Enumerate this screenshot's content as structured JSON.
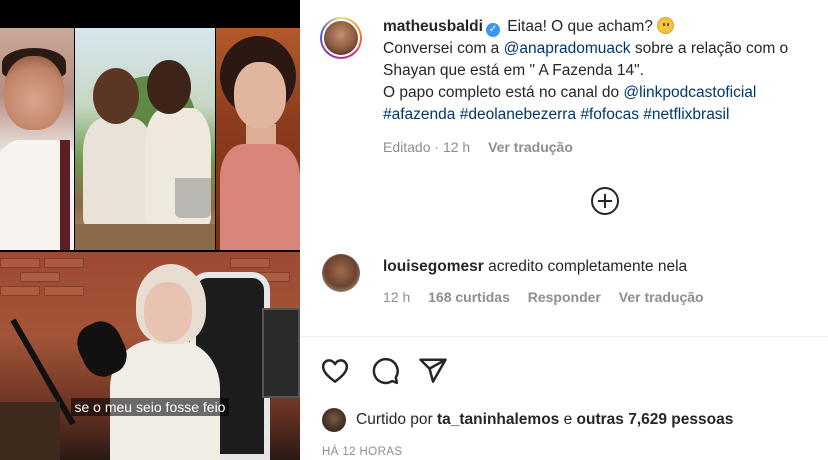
{
  "media": {
    "caption": "se o meu seio fosse feio"
  },
  "post": {
    "username": "matheusbaldi",
    "caption_intro": "Eitaa! O que acham?",
    "line2_prefix": "Conversei com a ",
    "mention_1": "@anapradomuack",
    "line2_suffix": " sobre a relação com o Shayan que está em \" A Fazenda 14\".",
    "line3_prefix": "O papo completo está no canal do ",
    "mention_2": "@linkpodcastoficial",
    "hashtags": [
      "#afazenda",
      "#deolanebezerra",
      "#fofocas",
      "#netflixbrasil"
    ],
    "edited_label": "Editado",
    "edited_time": "12 h",
    "see_translation": "Ver tradução"
  },
  "comment": {
    "username": "louisegomesr",
    "text": "acredito completamente nela",
    "time": "12 h",
    "likes": "168 curtidas",
    "reply": "Responder",
    "see_translation": "Ver tradução"
  },
  "likes": {
    "prefix": "Curtido por ",
    "user": "ta_taninhalemos",
    "middle": " e ",
    "others": "outras 7,629 pessoas"
  },
  "timestamp": "HÁ 12 HORAS",
  "colors": {
    "link": "#00376b",
    "muted": "#8e8e8e",
    "verified": "#3897f0"
  },
  "icons": [
    "verified-badge-icon",
    "grimacing-emoji-icon",
    "add-circle-icon",
    "heart-icon",
    "comment-icon",
    "share-icon"
  ]
}
